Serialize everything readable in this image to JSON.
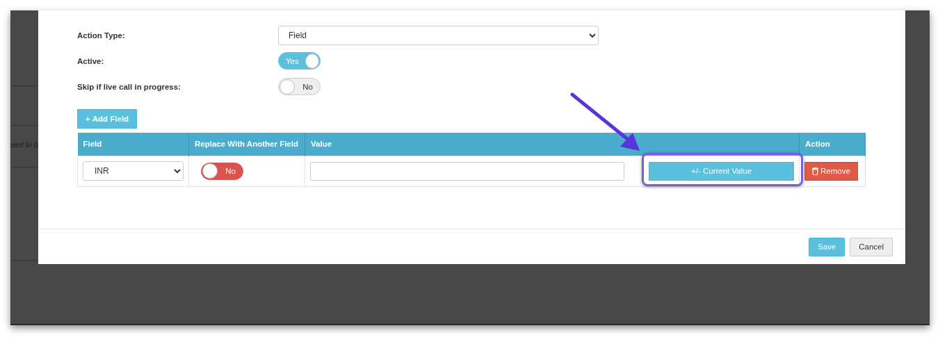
{
  "background": {
    "cut_text": "eed to b"
  },
  "form": [
    {
      "kind": "select",
      "label": "Action Type:",
      "value": "Field"
    },
    {
      "kind": "toggle",
      "label": "Active:",
      "on": true,
      "text": "Yes"
    },
    {
      "kind": "toggle",
      "label": "Skip if live call in progress:",
      "on": false,
      "text": "No"
    }
  ],
  "add_button": {
    "icon": "+",
    "label": "Add Field"
  },
  "table": {
    "columns": [
      "Field",
      "Replace With Another Field",
      "Value",
      "Action"
    ],
    "rows": [
      {
        "field": "INR",
        "replace": {
          "on": false,
          "text": "No"
        },
        "value": "",
        "value_button": "+/- Current Value",
        "action": "Remove"
      }
    ]
  },
  "annotation": {
    "highlighted": true
  },
  "footer": {
    "buttons": [
      {
        "label": "Save",
        "kind": "primary"
      },
      {
        "label": "Cancel",
        "kind": "default"
      }
    ]
  }
}
